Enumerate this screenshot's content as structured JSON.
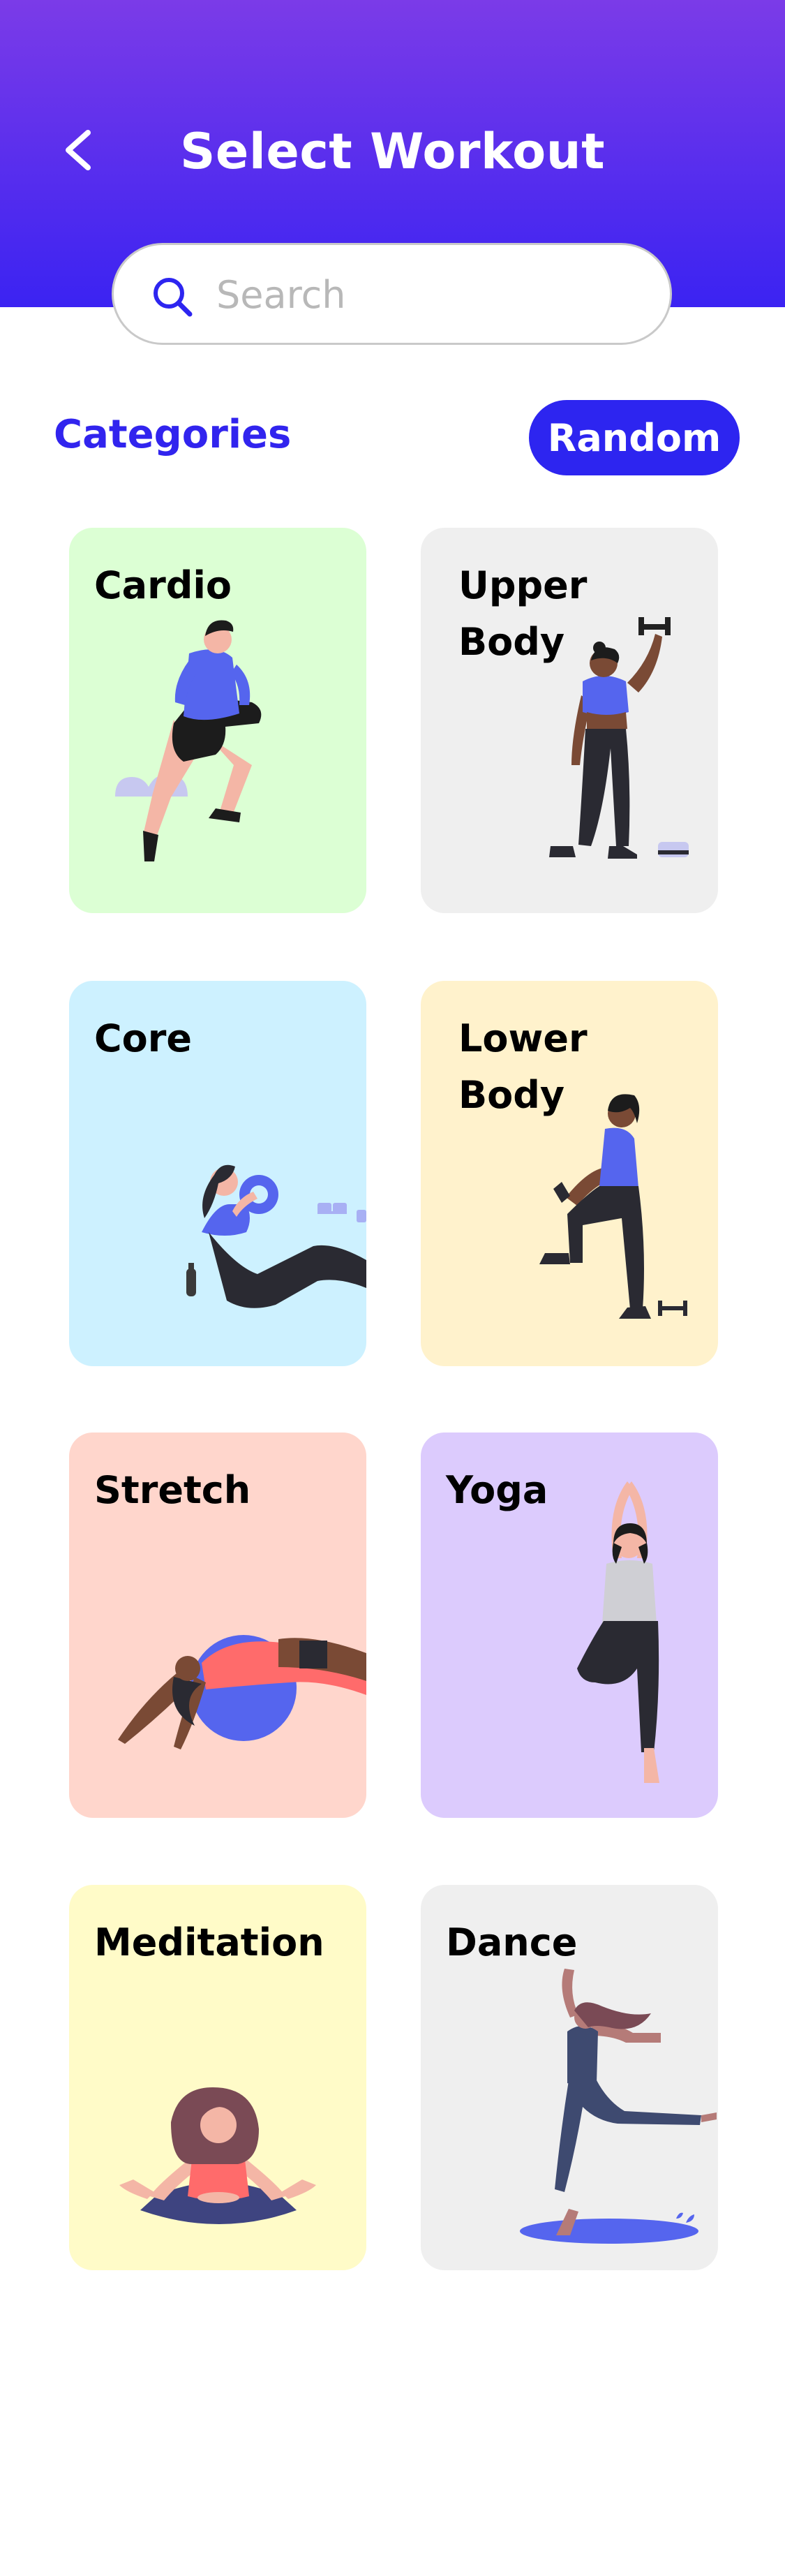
{
  "header": {
    "title": "Select Workout",
    "gradient": [
      "#7b3be8",
      "#3b23f2"
    ]
  },
  "search": {
    "placeholder": "Search",
    "value": ""
  },
  "categories": {
    "label": "Categories",
    "random_label": "Random",
    "accent_color": "#2d25f0",
    "items": [
      {
        "label": "Cardio",
        "color": "#dcffd4",
        "icon": "running-man-illustration"
      },
      {
        "label": "Upper\nBody",
        "color": "#efefef",
        "icon": "dumbbell-woman-illustration"
      },
      {
        "label": "Core",
        "color": "#cdf1ff",
        "icon": "situp-woman-illustration"
      },
      {
        "label": "Lower\nBody",
        "color": "#fff2cc",
        "icon": "lunge-woman-illustration"
      },
      {
        "label": "Stretch",
        "color": "#ffd6cc",
        "icon": "yoga-ball-stretch-illustration"
      },
      {
        "label": "Yoga",
        "color": "#dccbfd",
        "icon": "tree-pose-illustration"
      },
      {
        "label": "Meditation",
        "color": "#fffbc8",
        "icon": "meditation-illustration"
      },
      {
        "label": "Dance",
        "color": "#efefef",
        "icon": "dancer-illustration"
      }
    ]
  }
}
